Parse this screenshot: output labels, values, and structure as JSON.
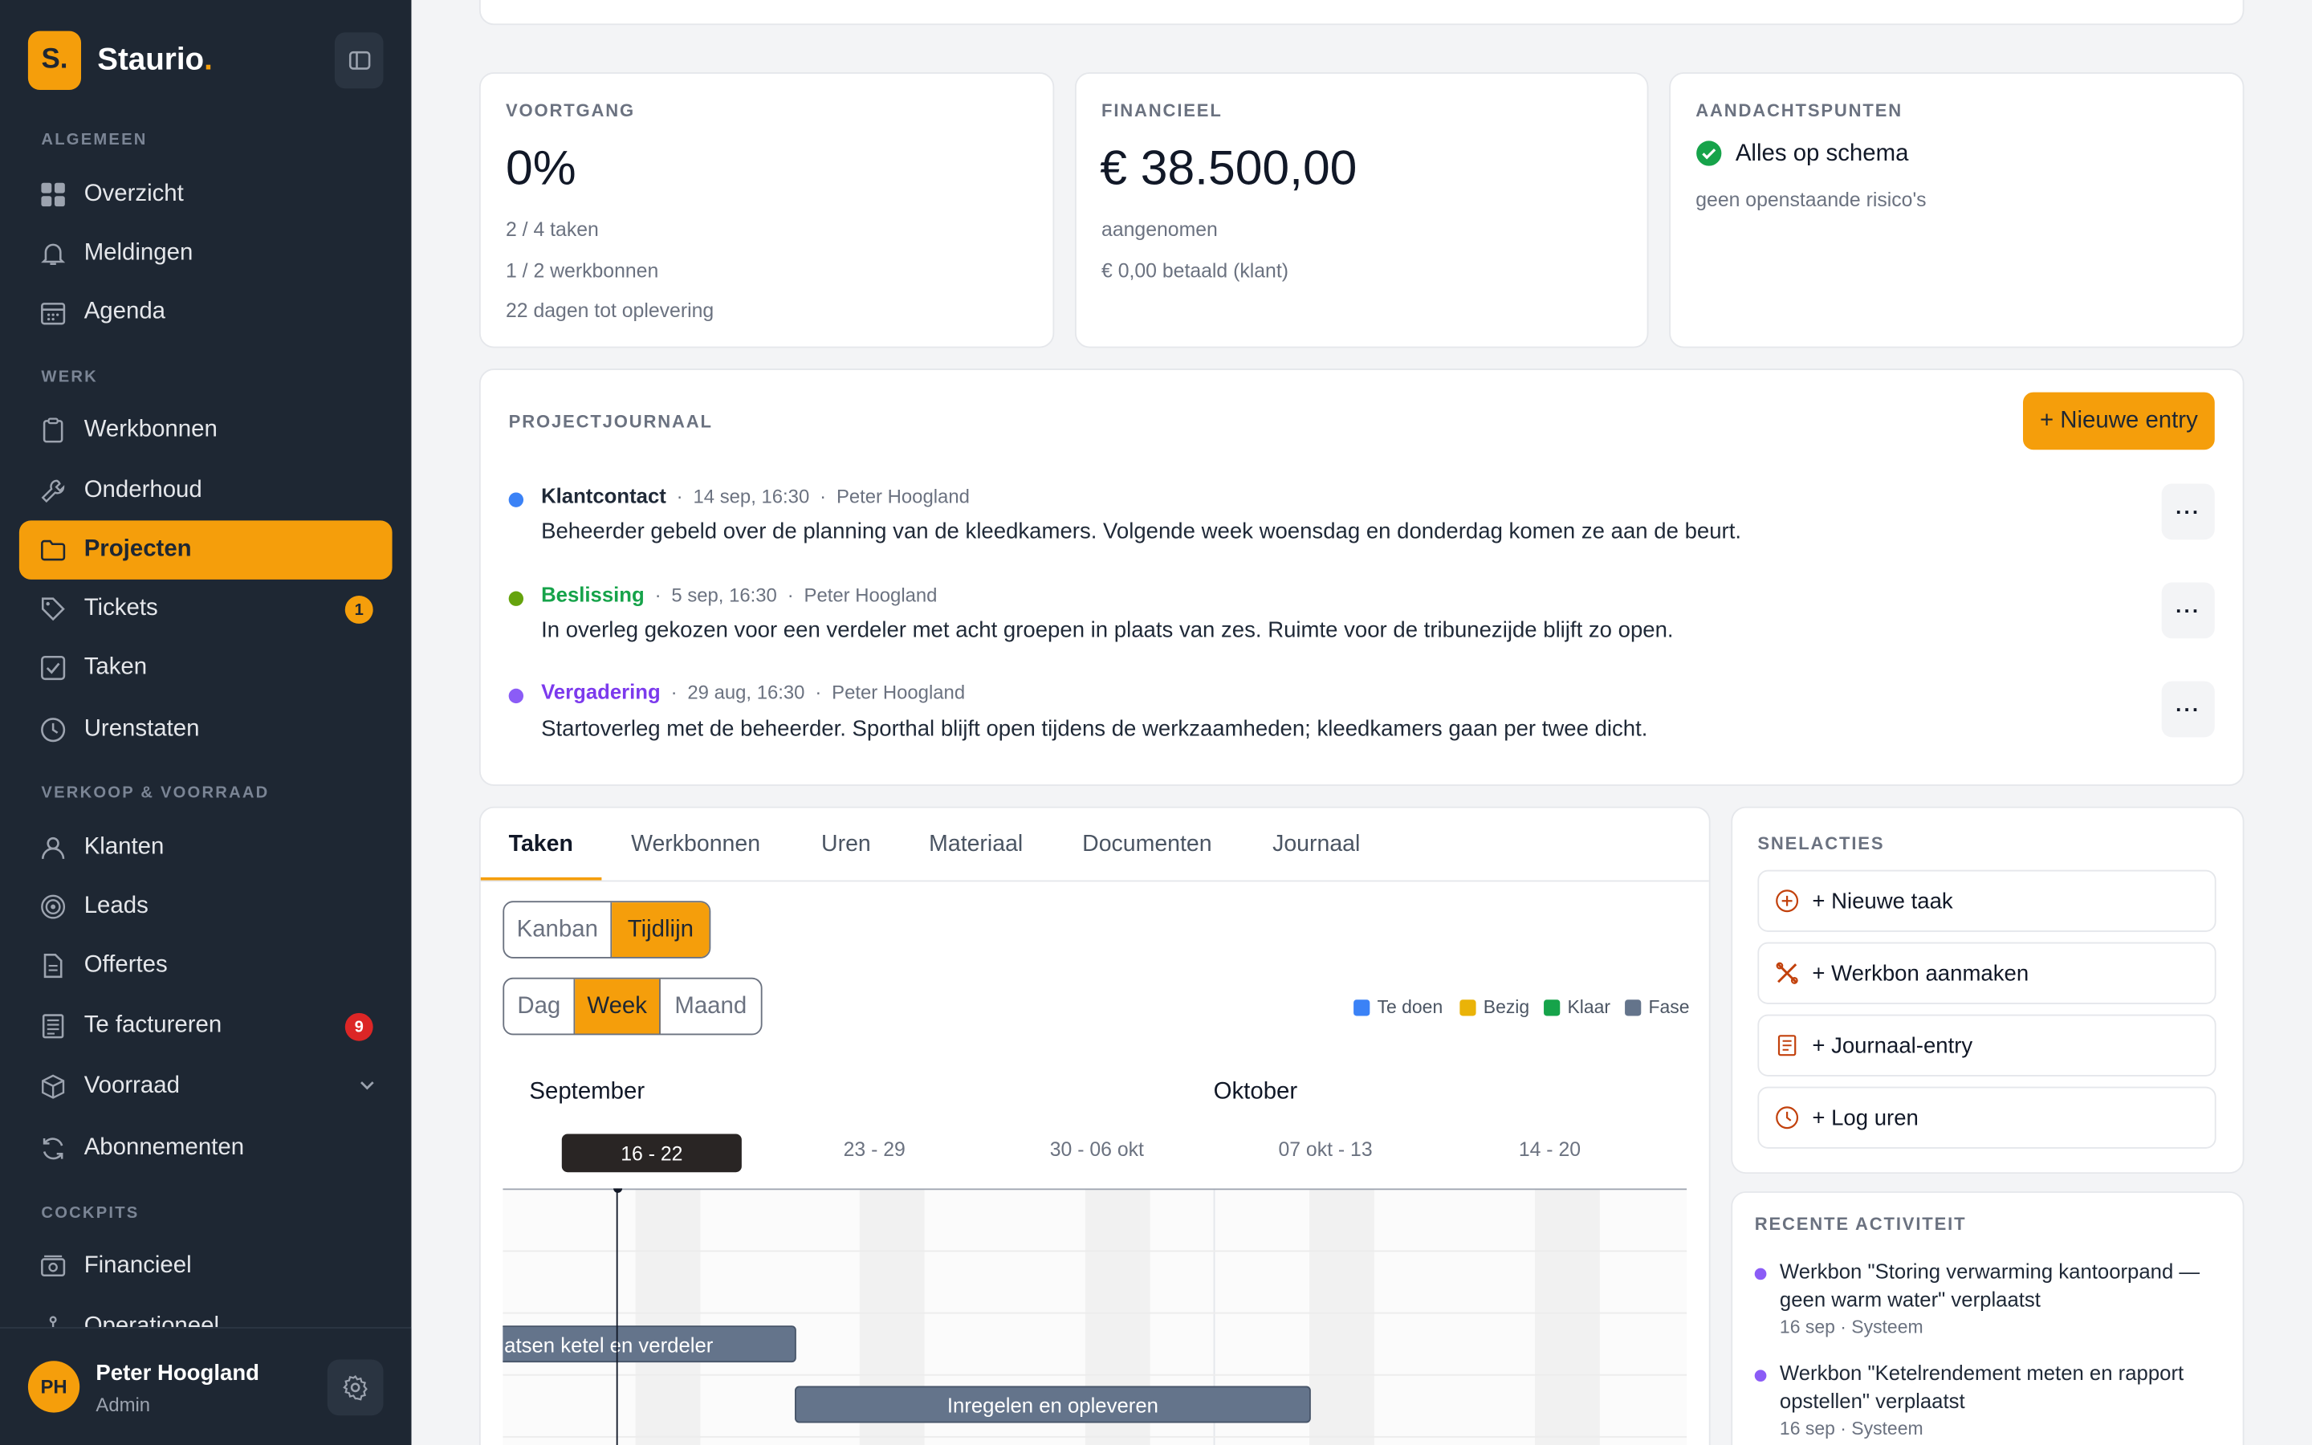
{
  "brand": {
    "letter": "S.",
    "name": "Staurio",
    "dot": "."
  },
  "sidebar": {
    "sections": [
      {
        "label": "ALGEMEEN"
      },
      {
        "label": "WERK"
      },
      {
        "label": "VERKOOP & VOORRAAD"
      },
      {
        "label": "COCKPITS"
      }
    ],
    "items": [
      {
        "label": "Overzicht",
        "icon": "grid-icon"
      },
      {
        "label": "Meldingen",
        "icon": "bell-icon"
      },
      {
        "label": "Agenda",
        "icon": "calendar-icon"
      },
      {
        "label": "Werkbonnen",
        "icon": "clipboard-icon"
      },
      {
        "label": "Onderhoud",
        "icon": "wrench-icon"
      },
      {
        "label": "Projecten",
        "icon": "folder-icon",
        "active": true
      },
      {
        "label": "Tickets",
        "icon": "tag-icon",
        "badge": "1"
      },
      {
        "label": "Taken",
        "icon": "checkbox-icon"
      },
      {
        "label": "Urenstaten",
        "icon": "clock-icon"
      },
      {
        "label": "Klanten",
        "icon": "user-icon"
      },
      {
        "label": "Leads",
        "icon": "target-icon"
      },
      {
        "label": "Offertes",
        "icon": "document-icon"
      },
      {
        "label": "Te factureren",
        "icon": "invoice-icon",
        "badge": "9"
      },
      {
        "label": "Voorraad",
        "icon": "box-icon"
      },
      {
        "label": "Abonnementen",
        "icon": "refresh-icon"
      },
      {
        "label": "Financieel",
        "icon": "money-icon"
      },
      {
        "label": "Operationeel",
        "icon": "gauge-icon"
      }
    ],
    "user": {
      "initials": "PH",
      "name": "Peter Hoogland",
      "role": "Admin"
    }
  },
  "stats": {
    "progress": {
      "label": "VOORTGANG",
      "value": "0%",
      "lines": [
        "2 / 4 taken",
        "1 / 2 werkbonnen",
        "22 dagen tot oplevering"
      ]
    },
    "finance": {
      "label": "FINANCIEEL",
      "value": "€ 38.500,00",
      "lines": [
        "aangenomen",
        "€ 0,00 betaald (klant)"
      ]
    },
    "attention": {
      "label": "AANDACHTSPUNTEN",
      "status": "Alles op schema",
      "sub": "geen openstaande risico's"
    }
  },
  "journal": {
    "label": "PROJECTJOURNAAL",
    "new_button": "+ Nieuwe entry",
    "entries": [
      {
        "type": "Klantcontact",
        "date": "14 sep, 16:30",
        "author": "Peter Hoogland",
        "text": "Beheerder gebeld over de planning van de kleedkamers. Volgende week woensdag en donderdag komen ze aan de beurt.",
        "color": "#3b82f6"
      },
      {
        "type": "Beslissing",
        "date": "5 sep, 16:30",
        "author": "Peter Hoogland",
        "text": "In overleg gekozen voor een verdeler met acht groepen in plaats van zes. Ruimte voor de tribunezijde blijft zo open.",
        "color": "#65a30d"
      },
      {
        "type": "Vergadering",
        "date": "29 aug, 16:30",
        "author": "Peter Hoogland",
        "text": "Startoverleg met de beheerder. Sporthal blijft open tijdens de werkzaamheden; kleedkamers gaan per twee dicht.",
        "color": "#8b5cf6"
      }
    ],
    "separator": "·",
    "more": "···"
  },
  "tabs": [
    "Taken",
    "Werkbonnen",
    "Uren",
    "Materiaal",
    "Documenten",
    "Journaal"
  ],
  "view_toggle": [
    "Kanban",
    "Tijdlijn"
  ],
  "range_toggle": [
    "Dag",
    "Week",
    "Maand"
  ],
  "legend": [
    {
      "label": "Te doen",
      "color": "#3b82f6"
    },
    {
      "label": "Bezig",
      "color": "#eab308"
    },
    {
      "label": "Klaar",
      "color": "#16a34a"
    },
    {
      "label": "Fase",
      "color": "#64748b"
    }
  ],
  "timeline": {
    "months": [
      "September",
      "Oktober"
    ],
    "weeks": [
      "16 - 22",
      "23 - 29",
      "30 - 06 okt",
      "07 okt - 13",
      "14 - 20"
    ],
    "bars": [
      "atsen ketel en verdeler",
      "Inregelen en opleveren"
    ]
  },
  "quick_actions": {
    "label": "SNELACTIES",
    "items": [
      {
        "label": "+ Nieuwe taak",
        "icon": "plus-circle-icon"
      },
      {
        "label": "+ Werkbon aanmaken",
        "icon": "tools-icon"
      },
      {
        "label": "+ Journaal-entry",
        "icon": "notebook-icon"
      },
      {
        "label": "+ Log uren",
        "icon": "clock-icon"
      }
    ]
  },
  "recent": {
    "label": "RECENTE ACTIVITEIT",
    "items": [
      {
        "text": "Werkbon \"Storing verwarming kantoorpand — geen warm water\" verplaatst",
        "meta": "16 sep · Systeem"
      },
      {
        "text": "Werkbon \"Ketelrendement meten en rapport opstellen\" verplaatst",
        "meta": "16 sep · Systeem"
      }
    ]
  },
  "colors": {
    "accent": "#f59e0b",
    "sidebar": "#1e2733"
  }
}
